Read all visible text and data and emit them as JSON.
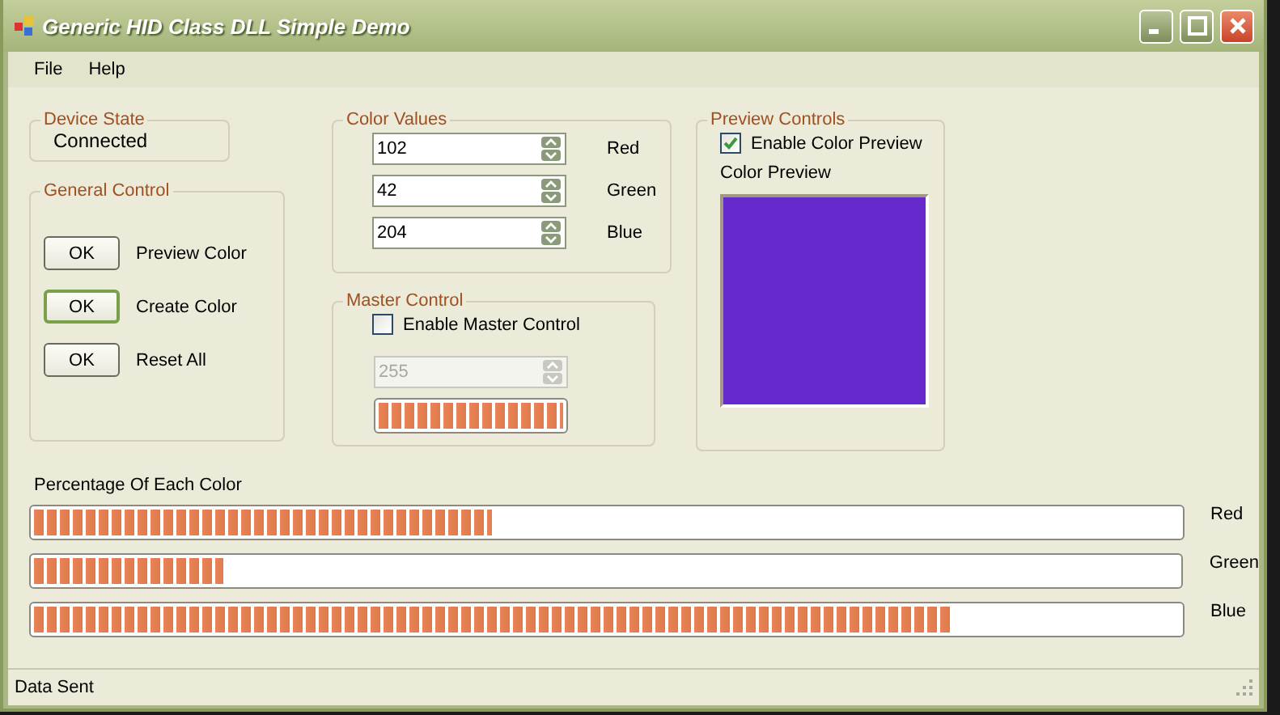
{
  "window": {
    "title": "Generic HID Class DLL Simple Demo"
  },
  "menu": [
    "File",
    "Help"
  ],
  "device_state": {
    "title": "Device State",
    "value": "Connected"
  },
  "general_control": {
    "title": "General Control",
    "buttons": [
      {
        "label": "OK",
        "caption": "Preview Color",
        "focused": false
      },
      {
        "label": "OK",
        "caption": "Create Color",
        "focused": true
      },
      {
        "label": "OK",
        "caption": "Reset All",
        "focused": false
      }
    ]
  },
  "color_values": {
    "title": "Color Values",
    "fields": [
      {
        "value": "102",
        "label": "Red"
      },
      {
        "value": "42",
        "label": "Green"
      },
      {
        "value": "204",
        "label": "Blue"
      }
    ]
  },
  "master_control": {
    "title": "Master Control",
    "checkbox": {
      "label": "Enable Master Control",
      "checked": false
    },
    "field": {
      "value": "255",
      "disabled": true
    },
    "level": 1
  },
  "preview_controls": {
    "title": "Preview Controls",
    "checkbox": {
      "label": "Enable Color Preview",
      "checked": true
    },
    "label": "Color Preview",
    "color": "#6629cc"
  },
  "percentages": {
    "title": "Percentage Of Each Color",
    "bars": [
      {
        "label": "Red",
        "level": 0.4
      },
      {
        "label": "Green",
        "level": 0.165
      },
      {
        "label": "Blue",
        "level": 0.8
      }
    ]
  },
  "status_bar": {
    "text": "Data Sent"
  }
}
